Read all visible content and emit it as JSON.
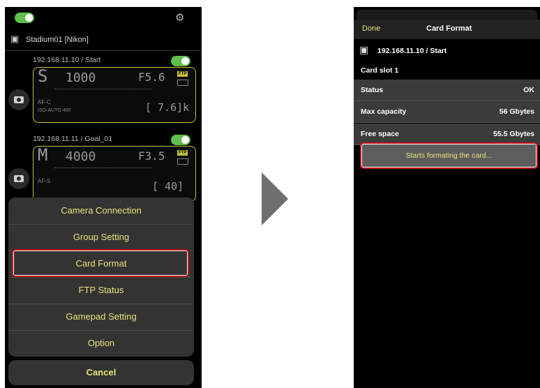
{
  "left": {
    "header_name": "Stadium01 [Nikon]",
    "cameras": [
      {
        "label": "192.168.11.10 / Start",
        "mode": "S",
        "shutter": "1000",
        "aperture": "F5.6",
        "af": "AF-C",
        "iso": "ISO-AUTO 400",
        "remaining": "[ 7.6]k",
        "ftp": "FTP"
      },
      {
        "label": "192.168.11.11 / Goal_01",
        "mode": "M",
        "shutter": "4000",
        "aperture": "F3.5",
        "af": "AF-S",
        "iso": "",
        "remaining": "[ 40]",
        "ftp": "FTP"
      }
    ],
    "menu": [
      "Camera Connection",
      "Group Setting",
      "Card Format",
      "FTP Status",
      "Gamepad Setting",
      "Option"
    ],
    "cancel": "Cancel"
  },
  "right": {
    "done": "Done",
    "title": "Card Format",
    "camera_label": "192.168.11.10 / Start",
    "slot": "Card slot 1",
    "rows": [
      {
        "label": "Status",
        "value": "OK"
      },
      {
        "label": "Max capacity",
        "value": "56 Gbytes"
      },
      {
        "label": "Free space",
        "value": "55.5 Gbytes"
      }
    ],
    "action": "Starts formating the card..."
  },
  "colors": {
    "accent_yellow": "#e8e57a",
    "toggle_green": "#5fbf4a",
    "highlight_red": "#c4131b"
  }
}
